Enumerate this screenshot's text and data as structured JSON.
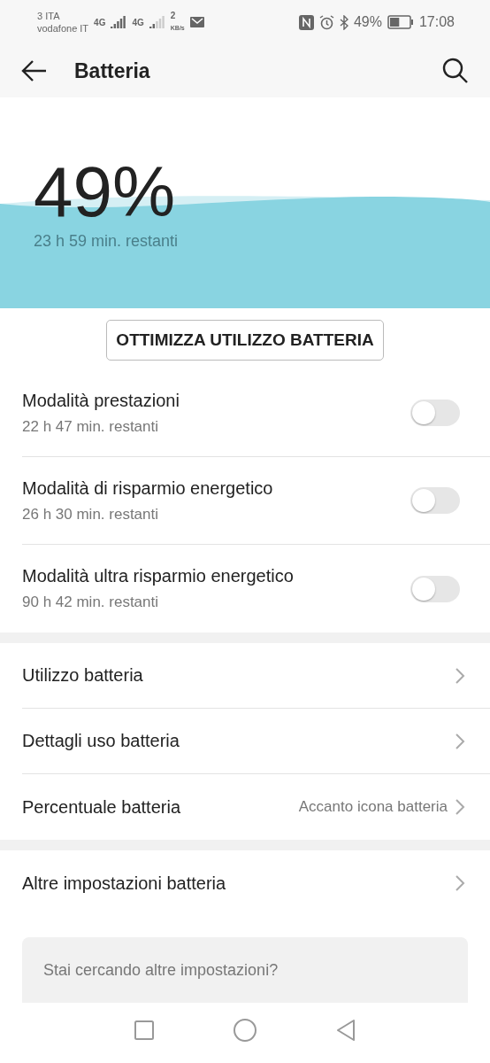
{
  "status_bar": {
    "carrier_1": "3 ITA",
    "carrier_2": "vodafone IT",
    "network_1": "4G",
    "network_2": "4G",
    "speed": "2",
    "speed_unit": "KB/s",
    "battery": "49%",
    "time": "17:08"
  },
  "app_bar": {
    "title": "Batteria"
  },
  "hero": {
    "percent": "49%",
    "remaining": "23 h 59 min. restanti"
  },
  "optimize_button": "OTTIMIZZA UTILIZZO BATTERIA",
  "modes": [
    {
      "title": "Modalità prestazioni",
      "subtitle": "22 h 47 min. restanti",
      "on": false
    },
    {
      "title": "Modalità di risparmio energetico",
      "subtitle": "26 h 30 min. restanti",
      "on": false
    },
    {
      "title": "Modalità ultra risparmio energetico",
      "subtitle": "90 h 42 min. restanti",
      "on": false
    }
  ],
  "settings": [
    {
      "label": "Utilizzo batteria"
    },
    {
      "label": "Dettagli uso batteria"
    },
    {
      "label": "Percentuale batteria",
      "value": "Accanto icona batteria"
    }
  ],
  "more_settings": [
    {
      "label": "Altre impostazioni batteria"
    }
  ],
  "search_card": {
    "placeholder": "Stai cercando altre impostazioni?"
  }
}
